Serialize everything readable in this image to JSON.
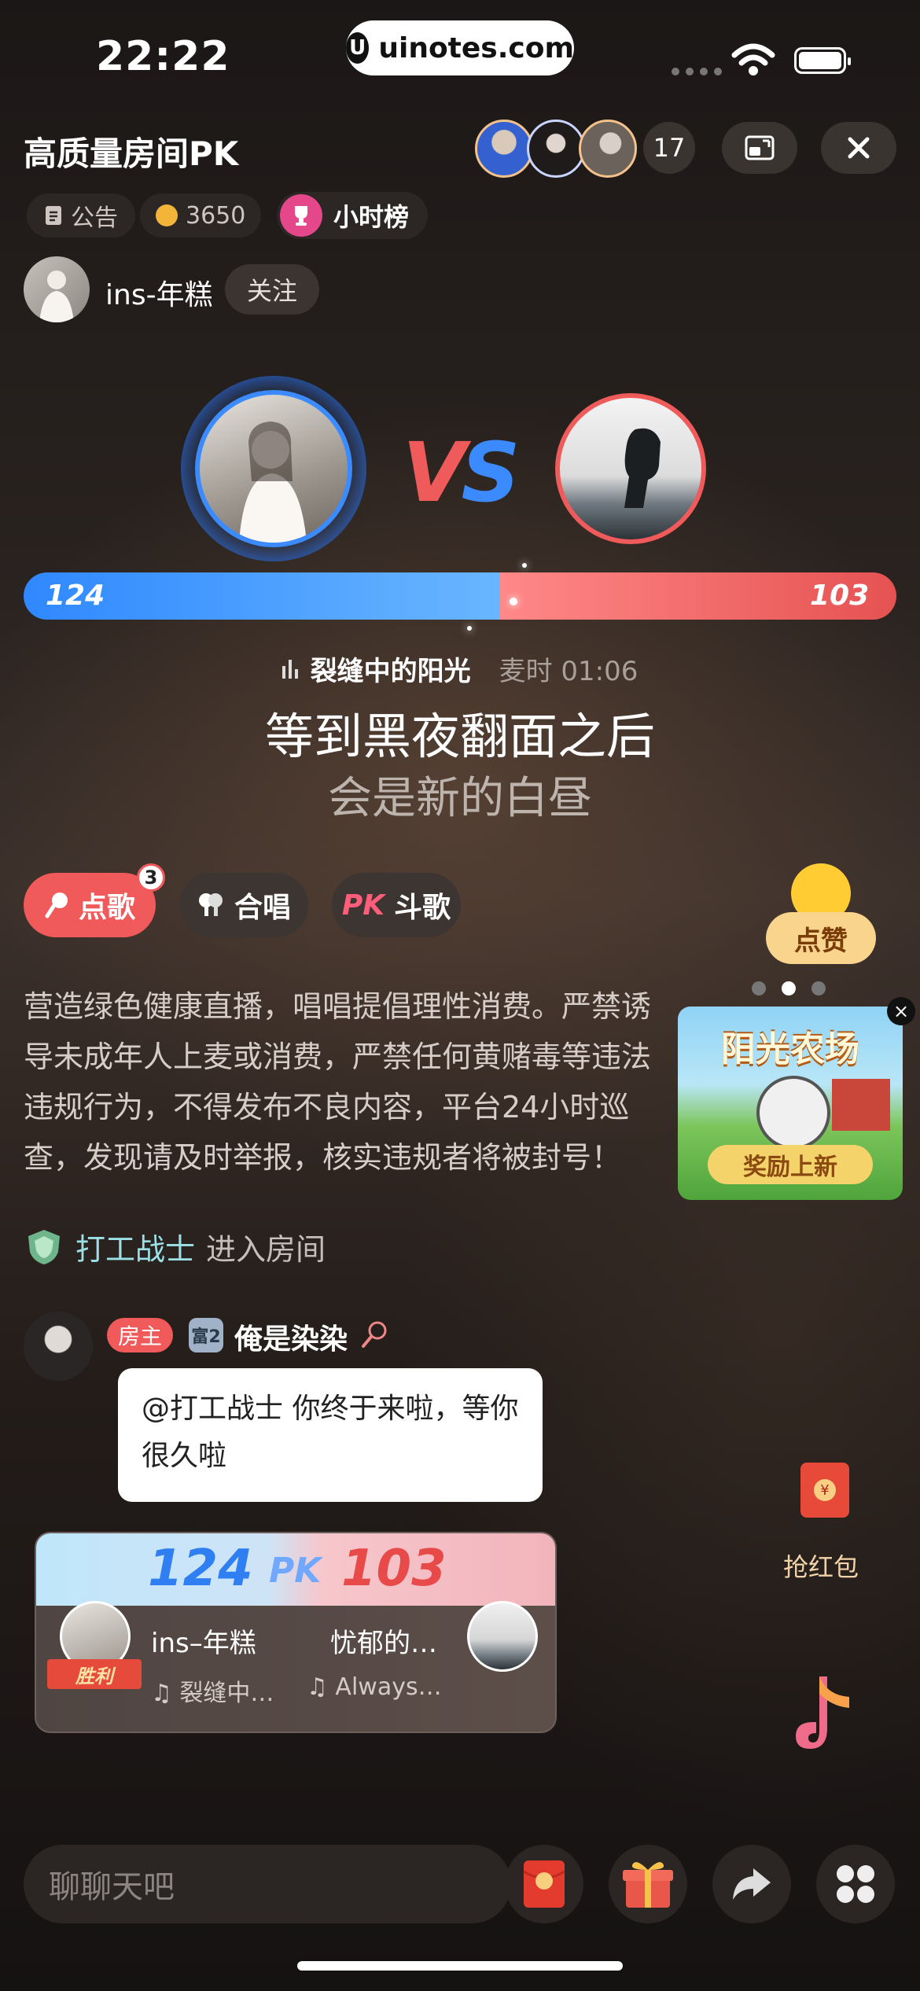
{
  "status_bar": {
    "time": "22:22",
    "url": "uinotes.com"
  },
  "header": {
    "room_title": "高质量房间PK",
    "viewer_count": "17",
    "notice_label": "公告",
    "coin_value": "3650",
    "rank_label": "小时榜"
  },
  "host": {
    "name": "ins-年糕",
    "follow_label": "关注"
  },
  "pk": {
    "left_score": "124",
    "right_score": "103",
    "left_fraction": 0.546,
    "vs_v": "V",
    "vs_s": "S"
  },
  "song": {
    "title": "裂缝中的阳光",
    "mic_time": "麦时 01:06",
    "lyric_line1": "等到黑夜翻面之后",
    "lyric_line2": "会是新的白昼"
  },
  "actions": {
    "song_label": "点歌",
    "song_badge": "3",
    "chorus_label": "合唱",
    "battle_label": "斗歌",
    "battle_pk": "PK",
    "like_label": "点赞"
  },
  "rules_text": "营造绿色健康直播，唱唱提倡理性消费。严禁诱导未成年人上麦或消费，严禁任何黄赌毒等违法违规行为，不得发布不良内容，平台24小时巡查，发现请及时举报，核实违规者将被封号！",
  "promo": {
    "title": "阳光农场",
    "button": "奖励上新",
    "close": "×"
  },
  "enter_event": {
    "user": "打工战士",
    "action": "进入房间"
  },
  "message": {
    "host_tag": "房主",
    "rich_tag": "富2",
    "sender": "俺是染染",
    "text": "@打工战士 你终于来啦，等你很久啦"
  },
  "red_packet": {
    "label": "抢红包",
    "symbol": "¥"
  },
  "pk_card": {
    "left_score": "124",
    "pk_label": "PK",
    "right_score": "103",
    "win_label": "胜利",
    "left_name": "ins–年糕",
    "right_name": "忧郁的…",
    "left_song": "♫ 裂缝中…",
    "right_song": "♫ Always…"
  },
  "bottom_bar": {
    "chat_placeholder": "聊聊天吧"
  },
  "colors": {
    "blue": "#2f88ff",
    "red": "#f05a5a",
    "gold": "#f2b53a"
  }
}
